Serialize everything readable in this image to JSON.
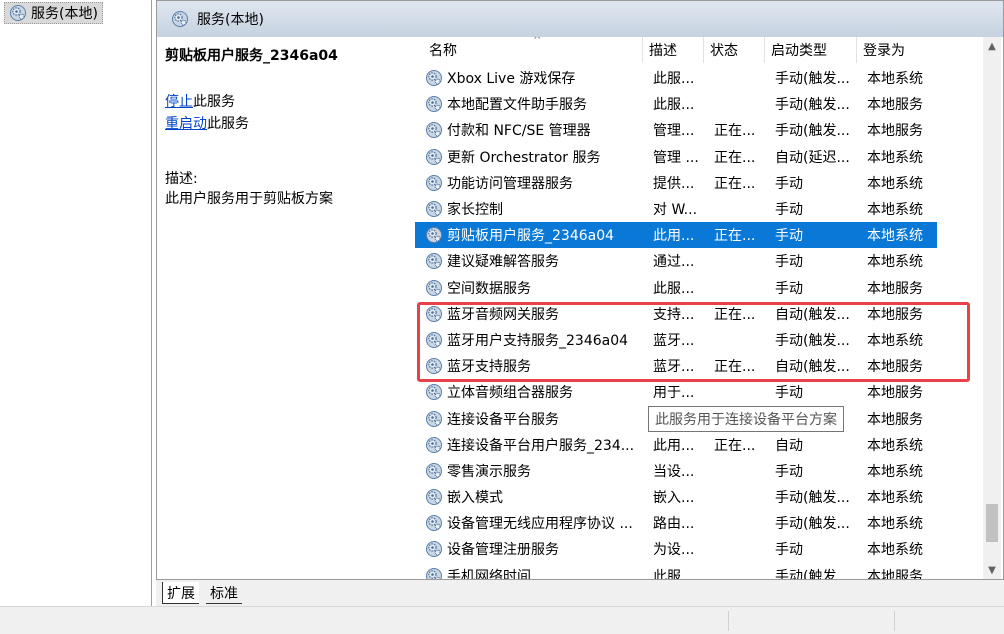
{
  "tree": {
    "item_label": "服务(本地)"
  },
  "header": {
    "title": "服务(本地)"
  },
  "detail": {
    "service_title": "剪贴板用户服务_2346a04",
    "stop_link": "停止",
    "stop_suffix": "此服务",
    "restart_link": "重启动",
    "restart_suffix": "此服务",
    "description_label": "描述:",
    "description_text": "此用户服务用于剪贴板方案"
  },
  "columns": {
    "name": "名称",
    "desc": "描述",
    "status": "状态",
    "startup": "启动类型",
    "logon": "登录为"
  },
  "services": [
    {
      "name": "Xbox Live 游戏保存",
      "desc": "此服...",
      "status": "",
      "startup": "手动(触发...",
      "logon": "本地系统"
    },
    {
      "name": "本地配置文件助手服务",
      "desc": "此服...",
      "status": "",
      "startup": "手动(触发...",
      "logon": "本地服务"
    },
    {
      "name": "付款和 NFC/SE 管理器",
      "desc": "管理...",
      "status": "正在...",
      "startup": "手动(触发...",
      "logon": "本地服务"
    },
    {
      "name": "更新 Orchestrator 服务",
      "desc": "管理 ...",
      "status": "正在...",
      "startup": "自动(延迟...",
      "logon": "本地系统"
    },
    {
      "name": "功能访问管理器服务",
      "desc": "提供...",
      "status": "正在...",
      "startup": "手动",
      "logon": "本地系统"
    },
    {
      "name": "家长控制",
      "desc": "对 W...",
      "status": "",
      "startup": "手动",
      "logon": "本地系统"
    },
    {
      "name": "剪贴板用户服务_2346a04",
      "desc": "此用...",
      "status": "正在...",
      "startup": "手动",
      "logon": "本地系统"
    },
    {
      "name": "建议疑难解答服务",
      "desc": "通过...",
      "status": "",
      "startup": "手动",
      "logon": "本地系统"
    },
    {
      "name": "空间数据服务",
      "desc": "此服...",
      "status": "",
      "startup": "手动",
      "logon": "本地服务"
    },
    {
      "name": "蓝牙音频网关服务",
      "desc": "支持...",
      "status": "正在...",
      "startup": "自动(触发...",
      "logon": "本地服务"
    },
    {
      "name": "蓝牙用户支持服务_2346a04",
      "desc": "蓝牙...",
      "status": "",
      "startup": "手动(触发...",
      "logon": "本地系统"
    },
    {
      "name": "蓝牙支持服务",
      "desc": "蓝牙...",
      "status": "正在...",
      "startup": "自动(触发...",
      "logon": "本地服务"
    },
    {
      "name": "立体音频组合器服务",
      "desc": "用于...",
      "status": "",
      "startup": "手动",
      "logon": "本地服务"
    },
    {
      "name": "连接设备平台服务",
      "desc": "",
      "status": "",
      "startup": "",
      "logon": "本地服务"
    },
    {
      "name": "连接设备平台用户服务_234...",
      "desc": "此用...",
      "status": "正在...",
      "startup": "自动",
      "logon": "本地系统"
    },
    {
      "name": "零售演示服务",
      "desc": "当设...",
      "status": "",
      "startup": "手动",
      "logon": "本地系统"
    },
    {
      "name": "嵌入模式",
      "desc": "嵌入...",
      "status": "",
      "startup": "手动(触发...",
      "logon": "本地系统"
    },
    {
      "name": "设备管理无线应用程序协议 ...",
      "desc": "路由...",
      "status": "",
      "startup": "手动(触发...",
      "logon": "本地系统"
    },
    {
      "name": "设备管理注册服务",
      "desc": "为设...",
      "status": "",
      "startup": "手动",
      "logon": "本地系统"
    },
    {
      "name": "手机网络时间",
      "desc": "此服...",
      "status": "",
      "startup": "手动(触发...",
      "logon": "本地服务"
    }
  ],
  "tooltip": "此服务用于连接设备平台方案",
  "tabs": {
    "extended": "扩展",
    "standard": "标准"
  },
  "colors": {
    "selection": "#0a78d7",
    "highlight_box": "#e8414a",
    "link": "#0044cc"
  }
}
